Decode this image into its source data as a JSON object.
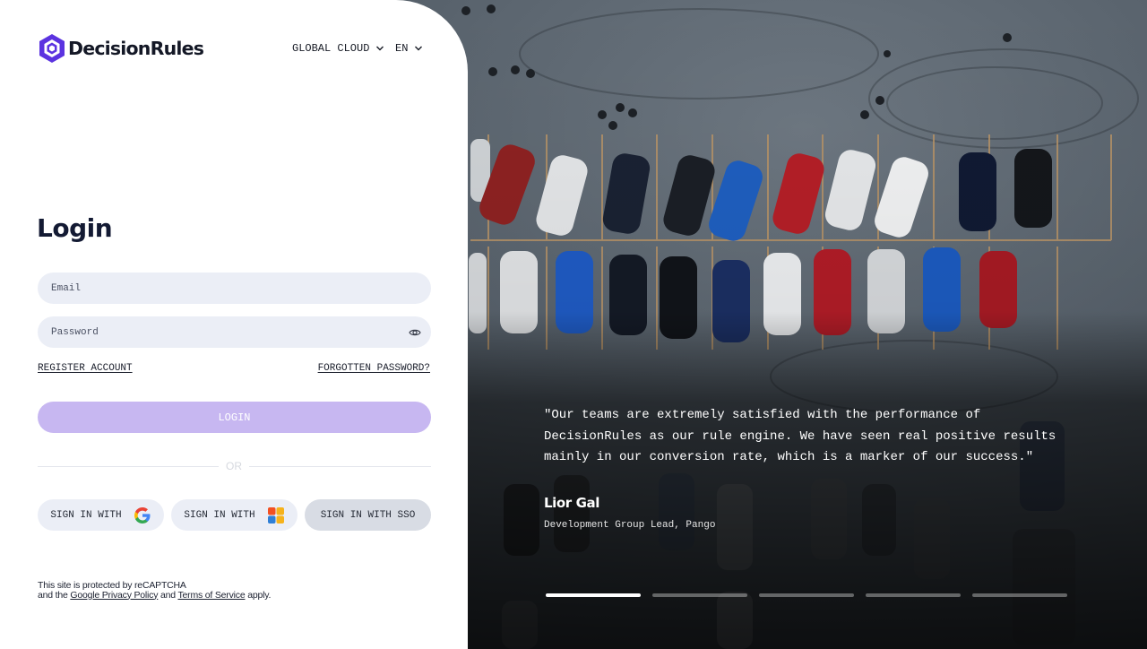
{
  "brand": {
    "name": "DecisionRules",
    "logo_icon": "hexagon-logo-icon",
    "accent": "#5b33e0"
  },
  "header": {
    "region": "GLOBAL CLOUD",
    "language": "EN"
  },
  "login": {
    "title": "Login",
    "email_placeholder": "Email",
    "password_placeholder": "Password",
    "register_label": "REGISTER ACCOUNT",
    "forgot_label": "FORGOTTEN PASSWORD?",
    "login_button": "LOGIN",
    "login_button_color": "#c7b7f1",
    "divider": "OR"
  },
  "social": {
    "google_label": "SIGN IN WITH",
    "microsoft_label": "SIGN IN WITH",
    "sso_label": "SIGN IN WITH SSO"
  },
  "recaptcha": {
    "line1": "This site is protected by reCAPTCHA",
    "and_the": "and the",
    "privacy": "Google Privacy Policy",
    "and": "and",
    "terms": "Terms of Service",
    "apply": "apply."
  },
  "testimonial": {
    "quote": "\"Our teams are extremely satisfied with the performance of DecisionRules as our rule engine. We have seen real positive results mainly in our conversion rate, which is a marker of our success.\"",
    "author": "Lior Gal",
    "role": "Development Group Lead, Pango",
    "slides_total": 5,
    "active_slide": 1
  }
}
